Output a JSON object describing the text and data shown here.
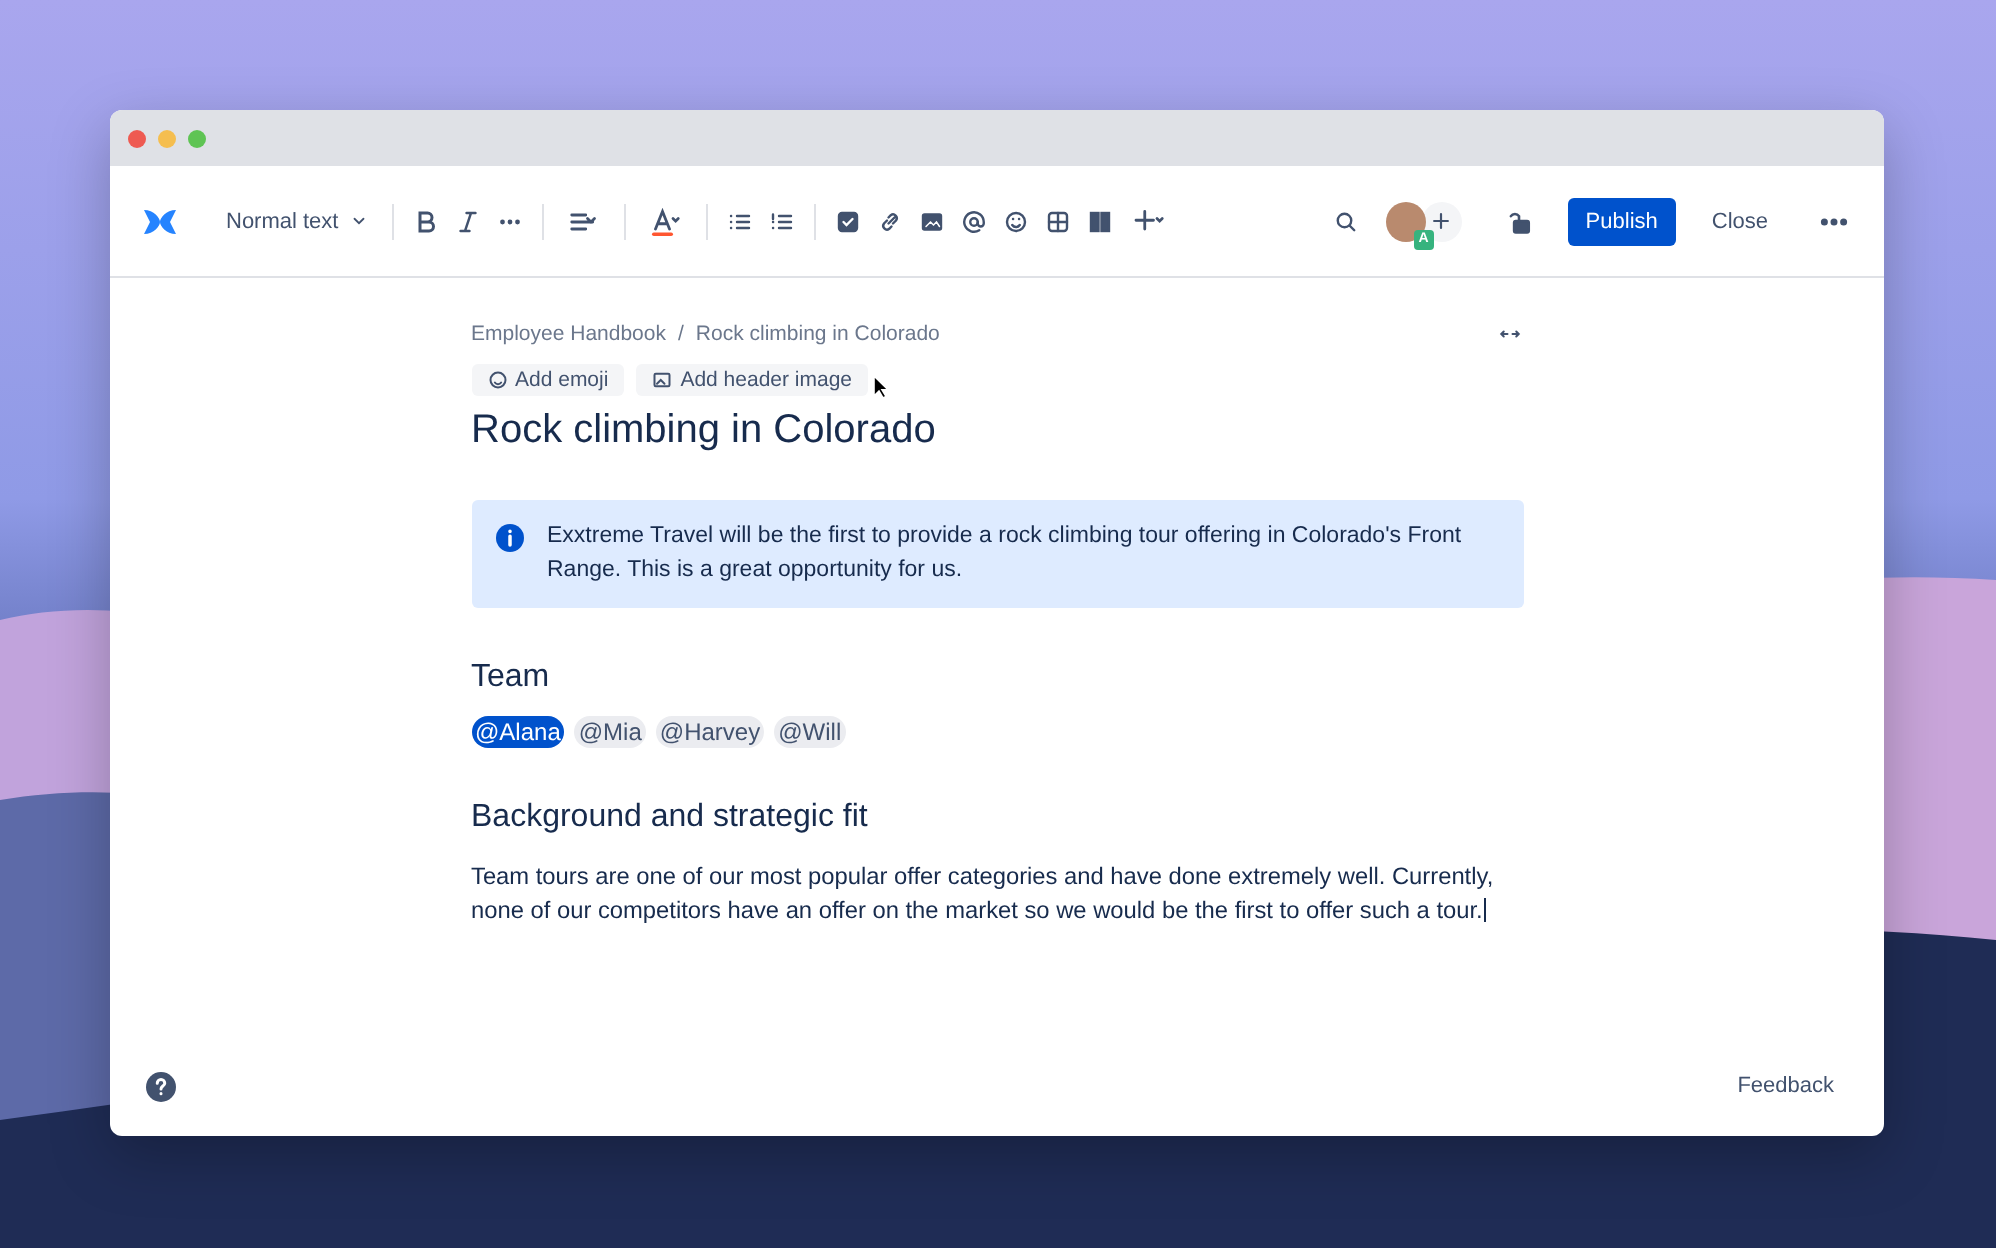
{
  "toolbar": {
    "text_style": "Normal text",
    "avatar_badge": "A",
    "publish": "Publish",
    "close": "Close"
  },
  "breadcrumbs": [
    "Employee Handbook",
    "Rock climbing in Colorado"
  ],
  "breadcrumb_separator": "/",
  "header_actions": [
    "Add emoji",
    "Add header image"
  ],
  "title": "Rock climbing in Colorado",
  "info_panel": "Exxtreme Travel will be the first to provide a rock climbing tour offering in Colorado's Front Range. This is a great opportunity for us.",
  "sections": [
    {
      "heading": "Team",
      "mentions": [
        {
          "label": "@Alana",
          "selected": true
        },
        {
          "label": "@Mia",
          "selected": false
        },
        {
          "label": "@Harvey",
          "selected": false
        },
        {
          "label": "@Will",
          "selected": false
        }
      ]
    },
    {
      "heading": "Background and strategic fit",
      "paragraph": "Team tours are one of our most popular offer categories and have done extremely well. Currently, none of our competitors have an offer on the market so we would be the first to offer such a tour."
    }
  ],
  "footer": {
    "feedback": "Feedback"
  }
}
